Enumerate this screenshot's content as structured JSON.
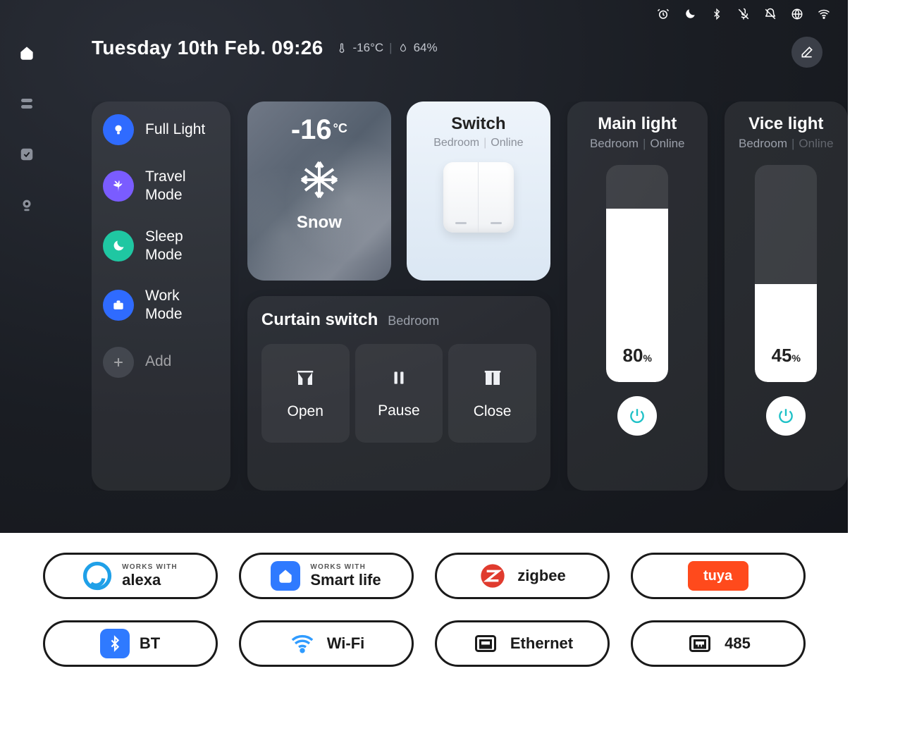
{
  "statusbar": {
    "icons": [
      "alarm-icon",
      "moon-icon",
      "bluetooth-icon",
      "mic-off-icon",
      "bell-off-icon",
      "globe-icon",
      "wifi-icon"
    ]
  },
  "header": {
    "datetime": "Tuesday 10th Feb. 09:26",
    "temp": "-16°C",
    "humidity": "64%"
  },
  "scenes": [
    {
      "icon": "bulb-icon",
      "label": "Full Light",
      "color": "#2f6bff"
    },
    {
      "icon": "palm-icon",
      "label": "Travel Mode",
      "color": "#7a5cff"
    },
    {
      "icon": "moon-icon",
      "label": "Sleep Mode",
      "color": "#1fc7a2"
    },
    {
      "icon": "briefcase-icon",
      "label": "Work Mode",
      "color": "#2f6bff"
    },
    {
      "icon": "plus-icon",
      "label": "Add",
      "color": "#565b64"
    }
  ],
  "weather": {
    "value": "-16",
    "unit": "°C",
    "condition": "Snow"
  },
  "switch": {
    "title": "Switch",
    "room": "Bedroom",
    "status": "Online"
  },
  "curtain": {
    "title": "Curtain switch",
    "room": "Bedroom",
    "buttons": {
      "open": "Open",
      "pause": "Pause",
      "close": "Close"
    }
  },
  "lights": [
    {
      "title": "Main light",
      "room": "Bedroom",
      "status": "Online",
      "percent": 80
    },
    {
      "title": "Vice light",
      "room": "Bedroom",
      "status": "Online",
      "percent": 45
    }
  ],
  "badges": {
    "row1": [
      {
        "icon": "alexa-icon",
        "small": "WORKS WITH",
        "big": "alexa"
      },
      {
        "icon": "smartlife-icon",
        "small": "WORKS WITH",
        "big": "Smart life"
      },
      {
        "icon": "zigbee-icon",
        "big": "zigbee"
      },
      {
        "icon": "tuya-icon",
        "big": "tuya"
      }
    ],
    "row2": [
      {
        "icon": "bluetooth-icon",
        "big": "BT"
      },
      {
        "icon": "wifi-icon",
        "big": "Wi-Fi"
      },
      {
        "icon": "ethernet-icon",
        "big": "Ethernet"
      },
      {
        "icon": "port485-icon",
        "big": "485"
      }
    ]
  },
  "icon_glyphs": {
    "alarm-icon": "⏰",
    "moon-icon": "☾",
    "bluetooth-icon": "ᛒ",
    "mic-off-icon": "🎤̸",
    "bell-off-icon": "🔕",
    "globe-icon": "🌐",
    "wifi-icon": "ᯤ"
  },
  "colors": {
    "power_accent": "#1fc1c7"
  }
}
